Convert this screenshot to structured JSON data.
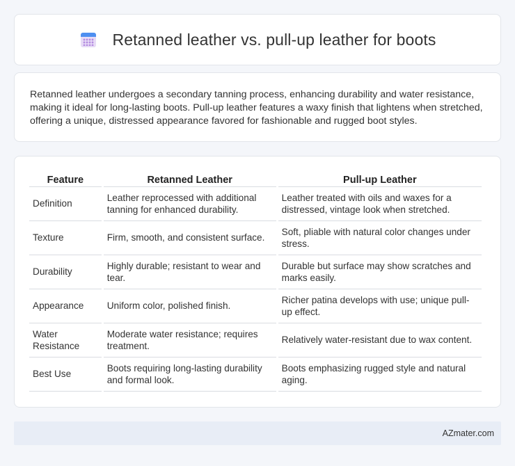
{
  "header": {
    "icon": "calendar-icon",
    "title": "Retanned leather vs. pull-up leather for boots"
  },
  "intro": {
    "text": "Retanned leather undergoes a secondary tanning process, enhancing durability and water resistance, making it ideal for long-lasting boots. Pull-up leather features a waxy finish that lightens when stretched, offering a unique, distressed appearance favored for fashionable and rugged boot styles."
  },
  "table": {
    "headers": [
      "Feature",
      "Retanned Leather",
      "Pull-up Leather"
    ],
    "rows": [
      [
        "Definition",
        "Leather reprocessed with additional tanning for enhanced durability.",
        "Leather treated with oils and waxes for a distressed, vintage look when stretched."
      ],
      [
        "Texture",
        "Firm, smooth, and consistent surface.",
        "Soft, pliable with natural color changes under stress."
      ],
      [
        "Durability",
        "Highly durable; resistant to wear and tear.",
        "Durable but surface may show scratches and marks easily."
      ],
      [
        "Appearance",
        "Uniform color, polished finish.",
        "Richer patina develops with use; unique pull-up effect."
      ],
      [
        "Water Resistance",
        "Moderate water resistance; requires treatment.",
        "Relatively water-resistant due to wax content."
      ],
      [
        "Best Use",
        "Boots requiring long-lasting durability and formal look.",
        "Boots emphasizing rugged style and natural aging."
      ]
    ]
  },
  "footer": {
    "brand": "AZmater.com"
  }
}
